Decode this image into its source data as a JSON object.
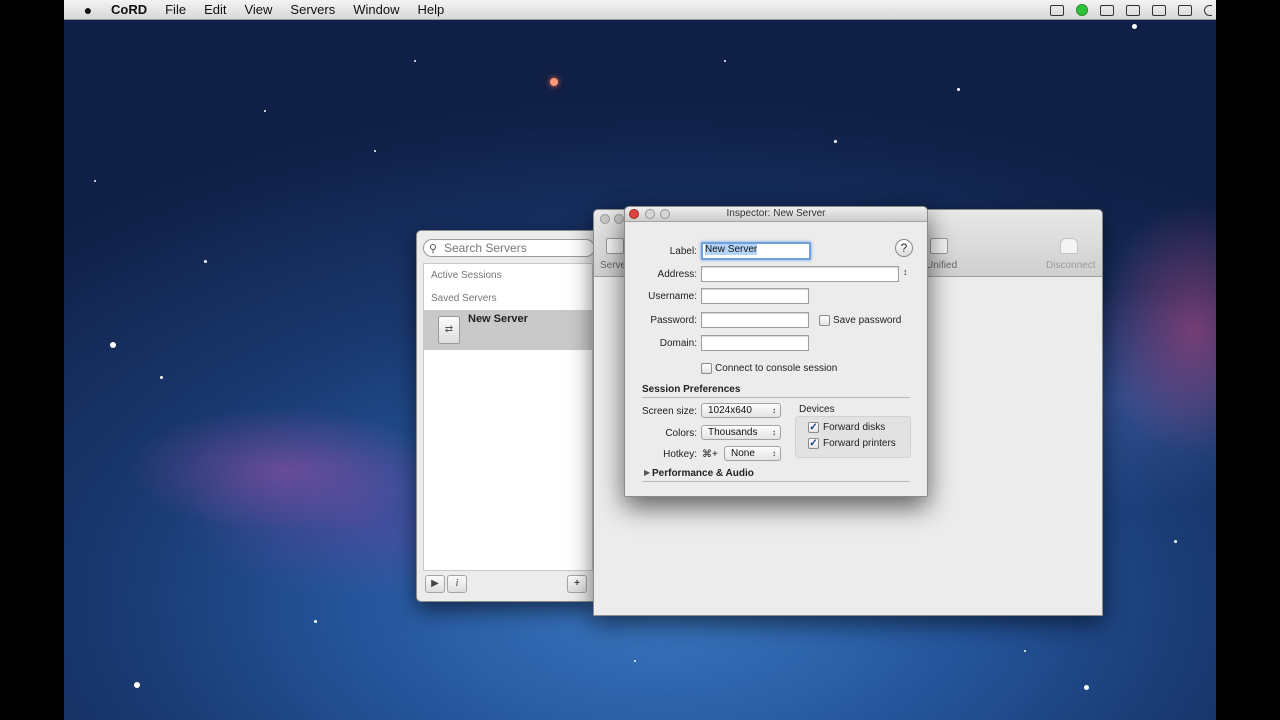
{
  "menubar": {
    "apple": "",
    "app": "CoRD",
    "items": [
      "File",
      "Edit",
      "View",
      "Servers",
      "Window",
      "Help"
    ]
  },
  "server_list": {
    "search_placeholder": "Search Servers",
    "active_sessions": "Active Sessions",
    "saved_servers": "Saved Servers",
    "selected_server": "New Server"
  },
  "main_window": {
    "toolbar": {
      "servers_label": "Serve",
      "unified_label": "Unified",
      "disconnect_label": "Disconnect"
    }
  },
  "inspector": {
    "title": "Inspector: New Server",
    "label_caption": "Label:",
    "label_value": "New Server",
    "address_caption": "Address:",
    "address_value": "",
    "username_caption": "Username:",
    "username_value": "",
    "password_caption": "Password:",
    "password_value": "",
    "save_password": "Save password",
    "domain_caption": "Domain:",
    "domain_value": "",
    "console_session": "Connect to console session",
    "session_prefs": "Session Preferences",
    "screen_size_caption": "Screen size:",
    "screen_size_value": "1024x640",
    "colors_caption": "Colors:",
    "colors_value": "Thousands",
    "hotkey_caption": "Hotkey:",
    "hotkey_modifier": "⌘+",
    "hotkey_value": "None",
    "devices_caption": "Devices",
    "forward_disks": "Forward disks",
    "forward_printers": "Forward printers",
    "forward_disks_checked": true,
    "forward_printers_checked": true,
    "save_password_checked": false,
    "console_session_checked": false,
    "perf_audio": "Performance & Audio"
  },
  "colors": {
    "focus_ring": "#6fa0df",
    "selected_row": "#c9c9c9",
    "close_red": "#e0443c",
    "minimize_yellow": "#e6b73a",
    "zoom_green": "#58b64a"
  }
}
